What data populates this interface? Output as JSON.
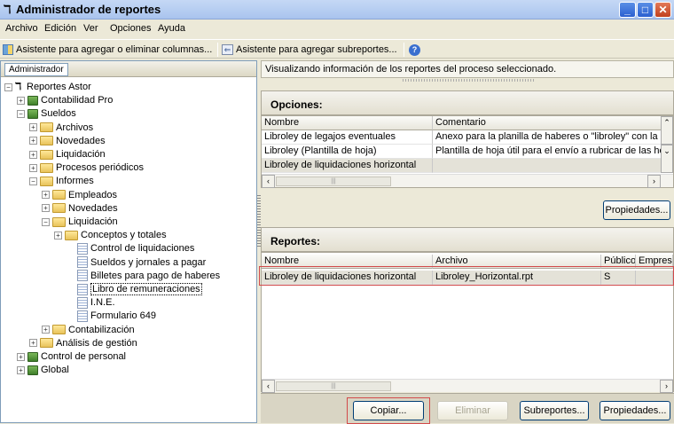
{
  "window": {
    "title": "Administrador de reportes"
  },
  "menu": [
    "Archivo",
    "Edición",
    "Ver",
    "Opciones",
    "Ayuda"
  ],
  "toolbar": {
    "add_columns": "Asistente para agregar o eliminar columnas...",
    "add_subreports": "Asistente para agregar subreportes..."
  },
  "left": {
    "tab": "Administrador",
    "tree": [
      {
        "label": "Reportes Astor",
        "kind": "root",
        "exp": "−"
      },
      {
        "label": "Contabilidad Pro",
        "kind": "app",
        "exp": "+"
      },
      {
        "label": "Sueldos",
        "kind": "app",
        "exp": "−"
      },
      {
        "label": "Archivos",
        "kind": "folder",
        "exp": "+"
      },
      {
        "label": "Novedades",
        "kind": "folder",
        "exp": "+"
      },
      {
        "label": "Liquidación",
        "kind": "folder",
        "exp": "+"
      },
      {
        "label": "Procesos periódicos",
        "kind": "folder",
        "exp": "+"
      },
      {
        "label": "Informes",
        "kind": "folder",
        "exp": "−"
      },
      {
        "label": "Empleados",
        "kind": "folder",
        "exp": "+"
      },
      {
        "label": "Novedades",
        "kind": "folder",
        "exp": "+"
      },
      {
        "label": "Liquidación",
        "kind": "folder",
        "exp": "−"
      },
      {
        "label": "Conceptos y totales",
        "kind": "folder",
        "exp": "+"
      },
      {
        "label": "Control de liquidaciones",
        "kind": "doc",
        "exp": ""
      },
      {
        "label": "Sueldos y jornales a pagar",
        "kind": "doc",
        "exp": ""
      },
      {
        "label": "Billetes para pago de haberes",
        "kind": "doc",
        "exp": ""
      },
      {
        "label": "Libro de remuneraciones",
        "kind": "doc",
        "exp": "",
        "selected": true
      },
      {
        "label": "I.N.E.",
        "kind": "doc",
        "exp": ""
      },
      {
        "label": "Formulario 649",
        "kind": "doc",
        "exp": ""
      },
      {
        "label": "Contabilización",
        "kind": "folder",
        "exp": "+"
      },
      {
        "label": "Análisis de gestión",
        "kind": "folder",
        "exp": "+"
      },
      {
        "label": "Control de personal",
        "kind": "app",
        "exp": "+"
      },
      {
        "label": "Global",
        "kind": "app",
        "exp": "+"
      }
    ]
  },
  "right": {
    "info": "Visualizando información de los reportes del proceso seleccionado.",
    "options": {
      "title": "Opciones:",
      "headers": [
        "Nombre",
        "Comentario"
      ],
      "rows": [
        [
          "Libroley de legajos eventuales",
          "Anexo para la planilla de haberes o \"libroley\" con la inform"
        ],
        [
          "Libroley (Plantilla de hoja)",
          "Plantilla de hoja útil para el envío a rubricar de las hojas c"
        ],
        [
          "Libroley de liquidaciones horizontal",
          ""
        ]
      ],
      "properties_button": "Propiedades..."
    },
    "reports": {
      "title": "Reportes:",
      "headers": [
        "Nombre",
        "Archivo",
        "Público",
        "Empresa"
      ],
      "rows": [
        [
          "Libroley de liquidaciones horizontal",
          "Libroley_Horizontal.rpt",
          "S",
          ""
        ]
      ]
    },
    "buttons": {
      "copy": "Copiar...",
      "delete": "Eliminar",
      "subreports": "Subreportes...",
      "properties": "Propiedades..."
    }
  },
  "colors": {
    "highlight_box": "#d24a4a",
    "title_bar": "#a9c4ee"
  }
}
